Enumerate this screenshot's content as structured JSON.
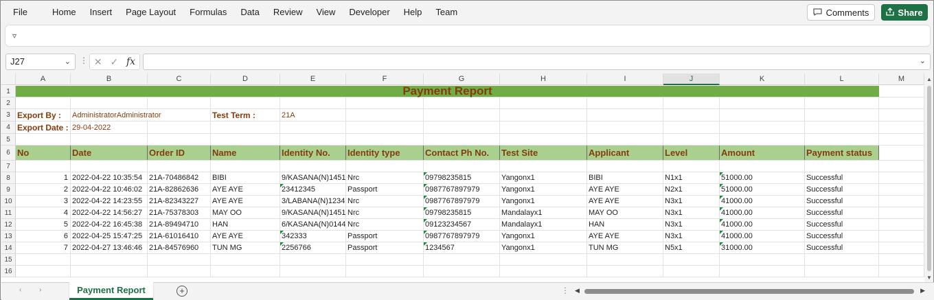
{
  "menu": [
    "File",
    "Home",
    "Insert",
    "Page Layout",
    "Formulas",
    "Data",
    "Review",
    "View",
    "Developer",
    "Help",
    "Team"
  ],
  "toolbar": {
    "comments_label": "Comments",
    "share_label": "Share",
    "ribbon_toggle": "▿"
  },
  "formula_bar": {
    "name_box": "J27",
    "formula": ""
  },
  "columns": [
    "A",
    "B",
    "C",
    "D",
    "E",
    "F",
    "G",
    "H",
    "I",
    "J",
    "K",
    "L",
    "M"
  ],
  "active_column": "J",
  "row_numbers": [
    "1",
    "2",
    "3",
    "4",
    "5",
    "6",
    "7",
    "8",
    "9",
    "10",
    "11",
    "12",
    "13",
    "14",
    "15",
    "16"
  ],
  "report": {
    "title": "Payment Report",
    "export_by_label": "Export By :",
    "export_by_value": "AdministratorAdministrator",
    "test_term_label": "Test Term :",
    "test_term_value": "21A",
    "export_date_label": "Export Date :",
    "export_date_value": "29-04-2022"
  },
  "headers": [
    "No",
    "Date",
    "Order ID",
    "Name",
    "Identity No.",
    "Identity type",
    "Contact Ph No.",
    "Test Site",
    "Applicant",
    "Level",
    "Amount",
    "Payment status"
  ],
  "rows": [
    [
      "1",
      "2022-04-22 10:35:54",
      "21A-70486842",
      "BIBI",
      "9/KASANA(N)1451",
      "Nrc",
      "09798235815",
      "Yangonx1",
      "BIBI",
      "N1x1",
      "51000.00",
      "Successful"
    ],
    [
      "2",
      "2022-04-22 10:46:02",
      "21A-82862636",
      "AYE AYE",
      "23412345",
      "Passport",
      "0987767897979",
      "Yangonx1",
      "AYE AYE",
      "N2x1",
      "51000.00",
      "Successful"
    ],
    [
      "3",
      "2022-04-22 14:23:55",
      "21A-82343227",
      "AYE AYE",
      "3/LABANA(N)1234",
      "Nrc",
      "0987767897979",
      "Yangonx1",
      "AYE AYE",
      "N3x1",
      "41000.00",
      "Successful"
    ],
    [
      "4",
      "2022-04-22 14:56:27",
      "21A-75378303",
      "MAY OO",
      "9/KASANA(N)1451",
      "Nrc",
      "09798235815",
      "Mandalayx1",
      "MAY OO",
      "N3x1",
      "41000.00",
      "Successful"
    ],
    [
      "5",
      "2022-04-22 16:45:38",
      "21A-89494710",
      "HAN",
      "6/KASANA(N)0144",
      "Nrc",
      "09123234567",
      "Mandalayx1",
      "HAN",
      "N3x1",
      "41000.00",
      "Successful"
    ],
    [
      "6",
      "2022-04-25 15:47:25",
      "21A-61016410",
      "AYE AYE",
      "342333",
      "Passport",
      "0987767897979",
      "Yangonx1",
      "AYE AYE",
      "N3x1",
      "41000.00",
      "Successful"
    ],
    [
      "7",
      "2022-04-27 13:46:46",
      "21A-84576960",
      "TUN MG",
      "2256766",
      "Passport",
      "1234567",
      "Yangonx1",
      "TUN MG",
      "N5x1",
      "31000.00",
      "Successful"
    ]
  ],
  "sheet_tab": "Payment Report",
  "add_sheet": "+",
  "colors": {
    "title_band": "#70ad47",
    "header_band": "#a9d08e",
    "label_text": "#843c0c",
    "accent": "#1e7145"
  }
}
